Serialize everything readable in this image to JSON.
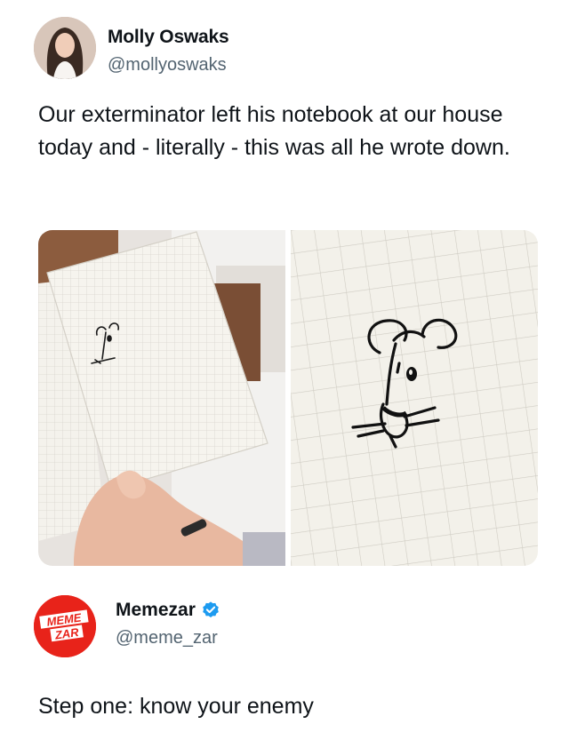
{
  "original_post": {
    "author_name": "Molly Oswaks",
    "author_handle": "@mollyoswaks",
    "text": "Our exterminator left his notebook at our house today and - literally - this was all he wrote down.",
    "media_count": 2
  },
  "reply": {
    "author_name": "Memezar",
    "author_handle": "@meme_zar",
    "verified": true,
    "avatar_logo_line1": "MEME",
    "avatar_logo_line2": "ZAR",
    "text": "Step one: know your enemy"
  },
  "colors": {
    "text_primary": "#0f1419",
    "text_secondary": "#536471",
    "verified_blue": "#1d9bf0",
    "memezar_red": "#e8231a"
  },
  "icons": {
    "verified": "verified-badge-icon"
  }
}
